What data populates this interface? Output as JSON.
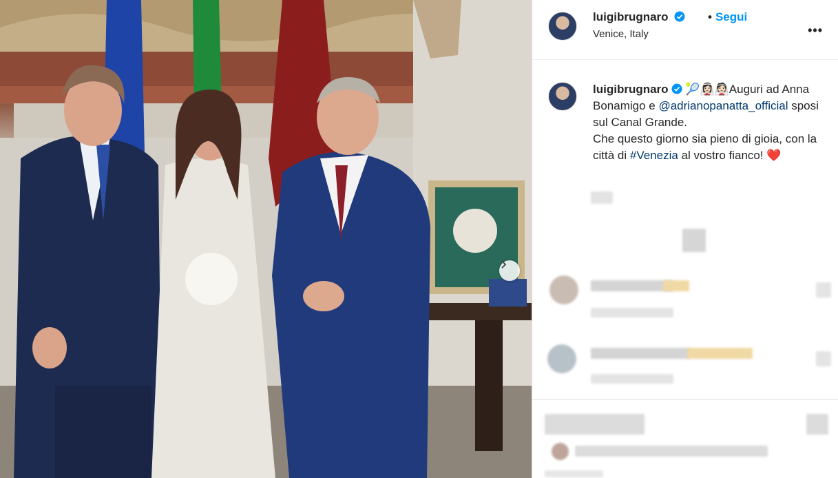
{
  "post": {
    "username": "luigibrugnaro",
    "location": "Venice, Italy",
    "follow_label": "Segui",
    "separator": "•",
    "more_label": "•••"
  },
  "caption": {
    "username": "luigibrugnaro",
    "emojis": "🎾👰🏻‍♀️👰🏻",
    "text_1": "Auguri ad Anna Bonamigo e ",
    "mention": "@adrianopanatta_official",
    "text_2": " sposi sul Canal Grande.",
    "text_3": "Che questo giorno sia pieno di gioia, con la città di ",
    "hashtag": "#Venezia",
    "text_4": " al vostro fianco! ",
    "heart": "❤️"
  },
  "icons": {
    "verified": "verified-badge-icon",
    "next": "chevron-right-icon",
    "more": "more-options-icon"
  },
  "colors": {
    "link": "#00376b",
    "follow": "#0095f6",
    "verified": "#0095f6"
  }
}
